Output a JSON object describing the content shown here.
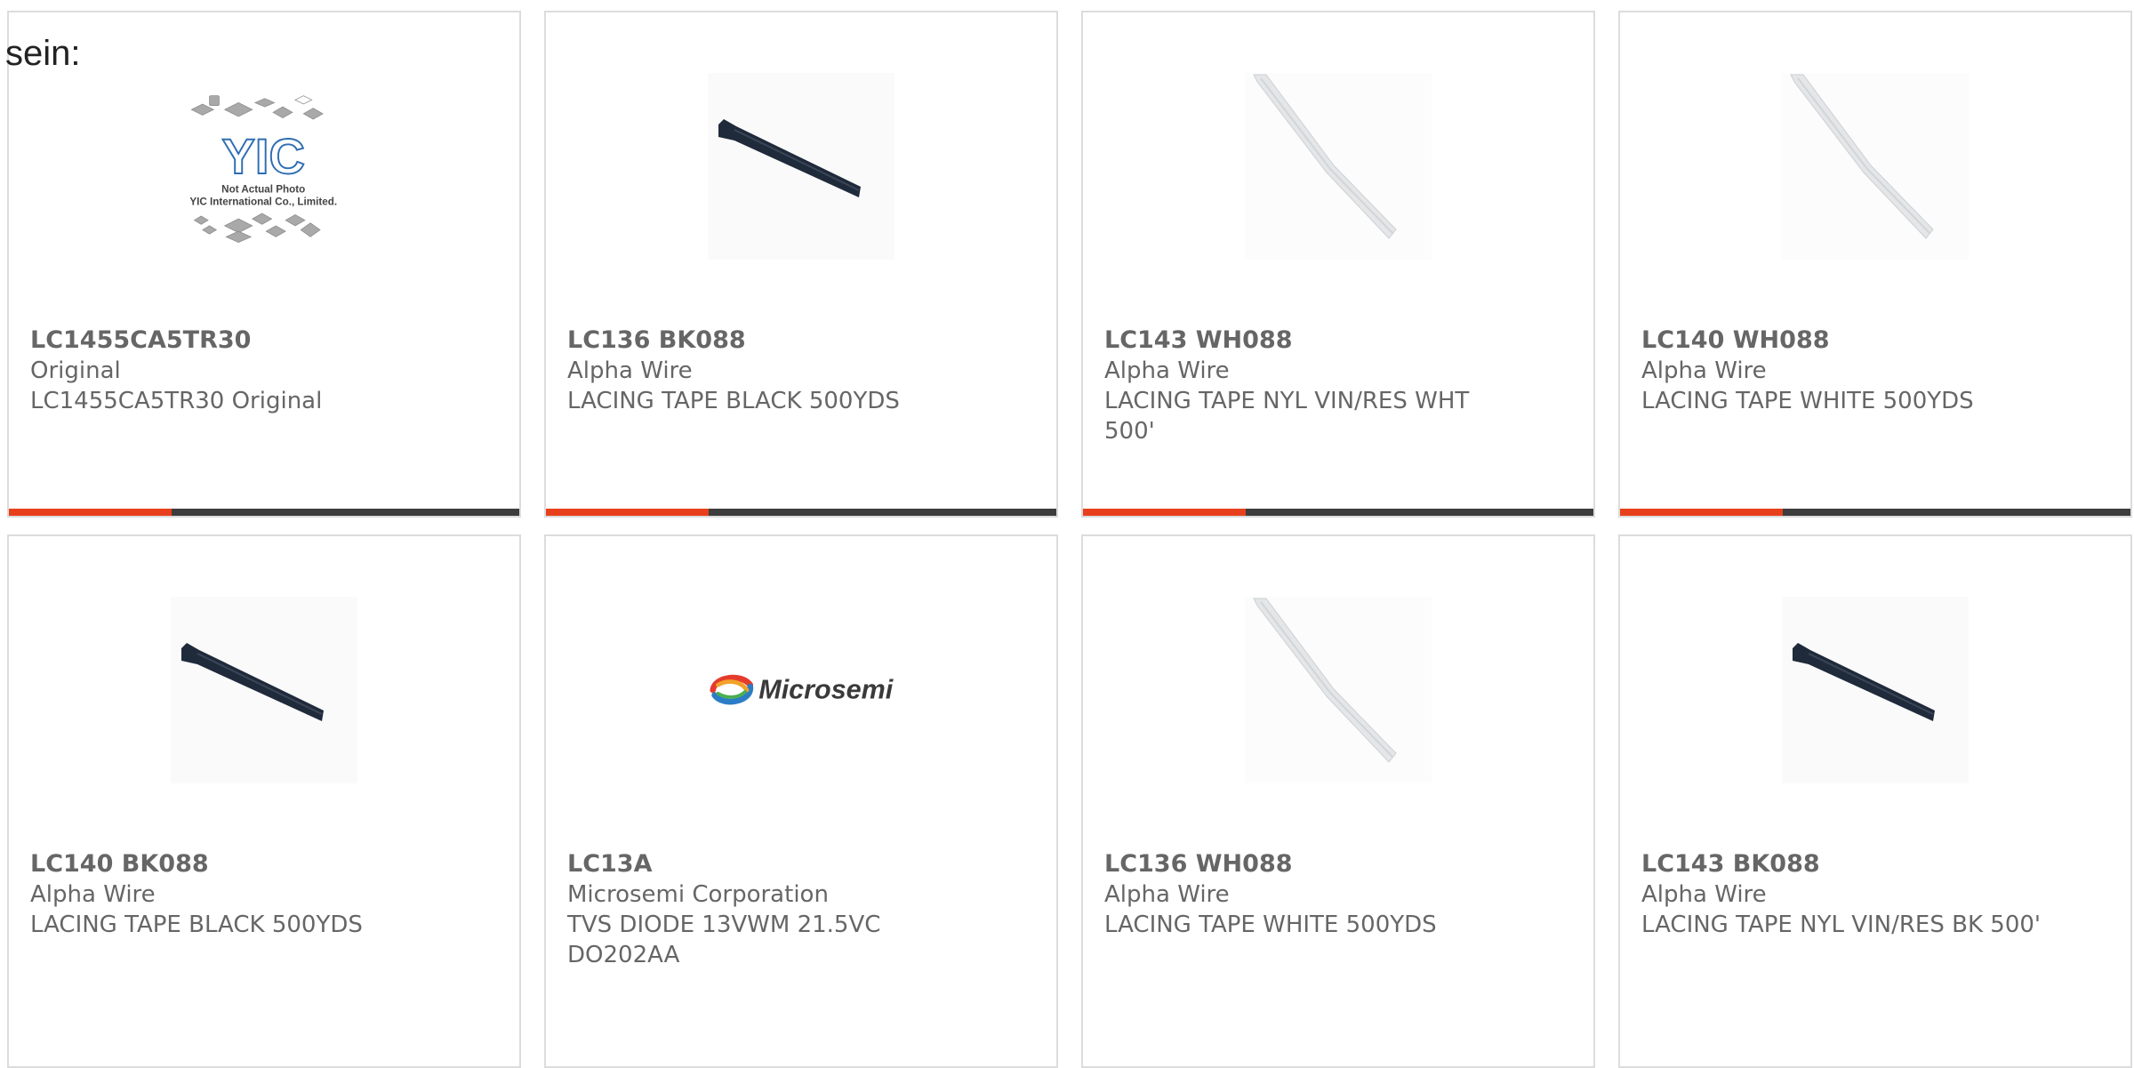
{
  "page": {
    "heading": "sein:"
  },
  "colors": {
    "accent": "#e8401c",
    "bar_dark": "#3d3d3d",
    "text": "#666666",
    "border": "#dcdcdc"
  },
  "products": [
    {
      "part_number": "LC1455CA5TR30",
      "manufacturer": "Original",
      "description": "LC1455CA5TR30 Original",
      "image": "yic-placeholder",
      "image_text": {
        "logo": "YIC",
        "line1": "Not Actual Photo",
        "line2": "YIC International Co., Limited."
      }
    },
    {
      "part_number": "LC136 BK088",
      "manufacturer": "Alpha Wire",
      "description": "LACING TAPE BLACK 500YDS",
      "image": "black-tape"
    },
    {
      "part_number": "LC143 WH088",
      "manufacturer": "Alpha Wire",
      "description": "LACING TAPE NYL VIN/RES WHT 500'",
      "image": "white-tape"
    },
    {
      "part_number": "LC140 WH088",
      "manufacturer": "Alpha Wire",
      "description": "LACING TAPE WHITE 500YDS",
      "image": "white-tape"
    },
    {
      "part_number": "LC140 BK088",
      "manufacturer": "Alpha Wire",
      "description": "LACING TAPE BLACK 500YDS",
      "image": "black-tape"
    },
    {
      "part_number": "LC13A",
      "manufacturer": "Microsemi Corporation",
      "description": "TVS DIODE 13VWM 21.5VC DO202AA",
      "image": "microsemi-logo",
      "image_text": {
        "logo": "Microsemi"
      }
    },
    {
      "part_number": "LC136 WH088",
      "manufacturer": "Alpha Wire",
      "description": "LACING TAPE WHITE 500YDS",
      "image": "white-tape"
    },
    {
      "part_number": "LC143 BK088",
      "manufacturer": "Alpha Wire",
      "description": "LACING TAPE NYL VIN/RES BK 500'",
      "image": "black-tape"
    }
  ]
}
